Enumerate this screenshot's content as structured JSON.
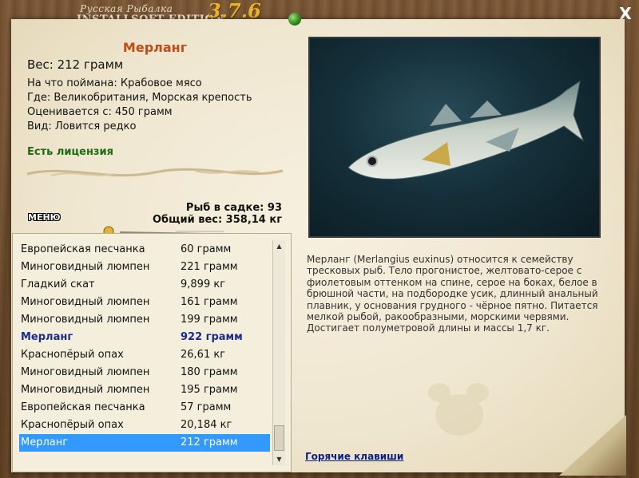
{
  "window": {
    "brand_small": "Русская Рыбалка",
    "brand_big": "INSTALLSOFT EDITION",
    "version": "3.7.6",
    "close_label": "X"
  },
  "fish": {
    "name": "Мерланг",
    "weight": "Вес: 212 грамм",
    "caught_on": "На что поймана: Крабовое мясо",
    "location": "Где: Великобритания, Морская крепость",
    "valued_from": "Оценивается с: 450 грамм",
    "kind": "Вид: Ловится редко",
    "license": "Есть лицензия"
  },
  "stats": {
    "in_keepnet": "Рыб в садке: 93",
    "total_weight": "Общий вес: 358,14 кг"
  },
  "menu_label": "МЕНЮ",
  "catch_list": [
    {
      "name": "Европейская песчанка",
      "weight": "60 грамм"
    },
    {
      "name": "Миноговидный люмпен",
      "weight": "221 грамм"
    },
    {
      "name": "Гладкий скат",
      "weight": "9,899 кг"
    },
    {
      "name": "Миноговидный люмпен",
      "weight": "161 грамм"
    },
    {
      "name": "Миноговидный люмпен",
      "weight": "199 грамм"
    },
    {
      "name": "Мерланг",
      "weight": "922 грамм"
    },
    {
      "name": "Краснопёрый опах",
      "weight": "26,61 кг"
    },
    {
      "name": "Миноговидный люмпен",
      "weight": "180 грамм"
    },
    {
      "name": "Миноговидный люмпен",
      "weight": "195 грамм"
    },
    {
      "name": "Европейская песчанка",
      "weight": "57 грамм"
    },
    {
      "name": "Краснопёрый опах",
      "weight": "20,184 кг"
    },
    {
      "name": "Мерланг",
      "weight": "212 грамм"
    }
  ],
  "description": "Мерланг (Merlangius euxinus) относится к семейству тресковых рыб. Тело прогонистое, желтовато-серое с фиолетовым оттенком на спине, серое на боках, белое в брюшной части, на подбородке усик, длинный анальный плавник, у основания грудного - чёрное пятно. Питается мелкой рыбой, ракообразными, морскими червями. Достигает полуметровой длины и массы 1,7 кг.",
  "hotkeys_label": "Горячие клавиши",
  "colors": {
    "fish_name": "#c44a16",
    "license": "#1d6b12",
    "highlight_row": "#1c2a8c",
    "selected_row_bg": "#3399ff",
    "version": "#e8b42a"
  }
}
